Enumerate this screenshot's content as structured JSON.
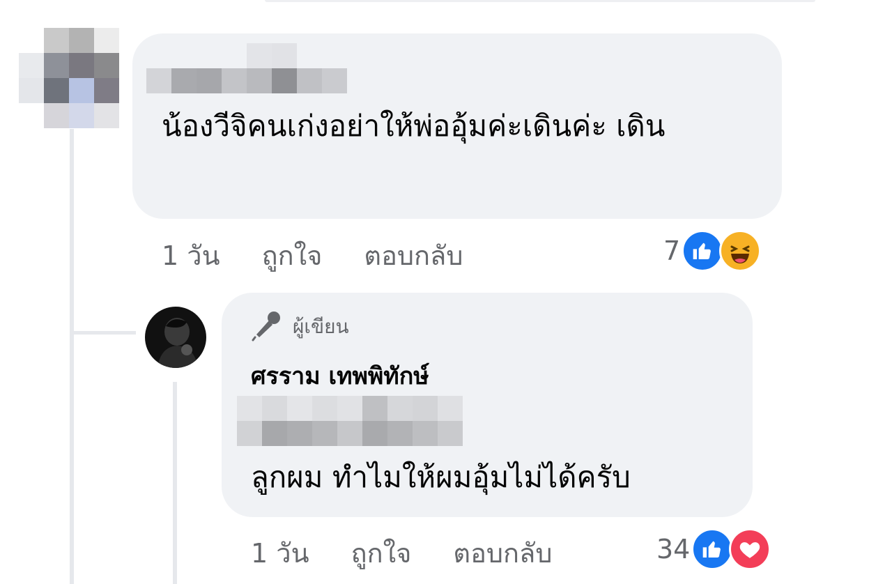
{
  "comment": {
    "text": "น้องวีจิคนเก่งอย่าให้พ่ออุ้มค่ะเดินค่ะ เดิน",
    "time": "1 วัน",
    "like_label": "ถูกใจ",
    "reply_label": "ตอบกลับ",
    "reaction_count": "7",
    "reactions": [
      "like-icon",
      "haha-icon"
    ]
  },
  "reply": {
    "badge": "ผู้เขียน",
    "badge_icon": "microphone-icon",
    "author": "ศรราม เทพพิทักษ์",
    "text": "ลูกผม ทำไมให้ผมอุ้มไม่ได้ครับ",
    "time": "1 วัน",
    "like_label": "ถูกใจ",
    "reply_label": "ตอบกลับ",
    "reaction_count": "34",
    "reactions": [
      "like-icon",
      "love-icon"
    ]
  },
  "colors": {
    "bubble": "#f0f2f5",
    "meta_text": "#65676b",
    "like_blue": "#1877f2",
    "haha_yellow": "#f7b125",
    "love_red": "#f33e58",
    "thread_line": "#e6e8ec"
  }
}
